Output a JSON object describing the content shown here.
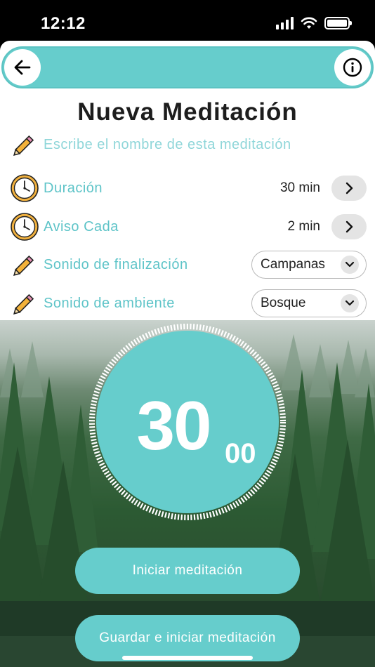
{
  "status": {
    "time": "12:12"
  },
  "header": {
    "back_icon": "arrow-left-icon",
    "info_icon": "info-circle-icon"
  },
  "page": {
    "title": "Nueva Meditación"
  },
  "name_field": {
    "placeholder": "Escribe el nombre de esta meditación",
    "icon": "pencil-icon"
  },
  "settings": {
    "duration": {
      "label": "Duración",
      "value": "30 min",
      "icon": "clock-icon"
    },
    "interval": {
      "label": "Aviso Cada",
      "value": "2 min",
      "icon": "clock-icon"
    },
    "end_sound": {
      "label": "Sonido de finalización",
      "value": "Campanas",
      "icon": "pencil-icon"
    },
    "ambient_sound": {
      "label": "Sonido de ambiente",
      "value": "Bosque",
      "icon": "pencil-icon"
    }
  },
  "timer": {
    "minutes": "30",
    "seconds": "00"
  },
  "actions": {
    "start_label": "Iniciar meditación",
    "save_start_label": "Guardar e iniciar meditación"
  },
  "colors": {
    "accent": "#66cdcc",
    "label": "#5ec4c8",
    "title": "#1d1d1d"
  }
}
